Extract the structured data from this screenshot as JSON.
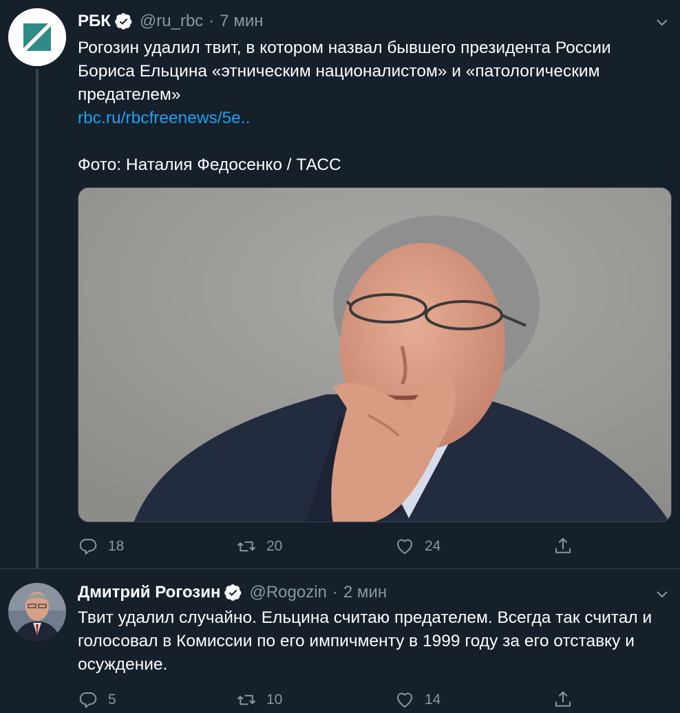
{
  "tweets": [
    {
      "name": "РБК",
      "handle": "@ru_rbc",
      "separator": "·",
      "time": "7 мин",
      "text": "Рогозин удалил твит, в котором назвал бывшего президента России Бориса Ельцина «этническим националистом» и «патологическим предателем»",
      "link": "rbc.ru/rbcfreenews/5e..",
      "credit": "Фото: Наталия Федосенко / ТАСС",
      "replies": "18",
      "retweets": "20",
      "likes": "24"
    },
    {
      "name": "Дмитрий Рогозин",
      "handle": "@Rogozin",
      "separator": "·",
      "time": "2 мин",
      "text": "Твит удалил случайно. Ельцина считаю предателем. Всегда так считал и голосовал в Комиссии по его импичменту в 1999 году за его отставку и осуждение.",
      "replies": "5",
      "retweets": "10",
      "likes": "14"
    }
  ],
  "icons": {
    "verified": "verified-badge-icon",
    "caret": "chevron-down-icon",
    "reply": "reply-icon",
    "retweet": "retweet-icon",
    "like": "heart-icon",
    "share": "share-icon"
  },
  "colors": {
    "background": "#15202b",
    "text": "#ffffff",
    "muted": "#8899a6",
    "link": "#1da1f2",
    "border": "#38444d",
    "rbc_logo": "#2e8b86"
  }
}
